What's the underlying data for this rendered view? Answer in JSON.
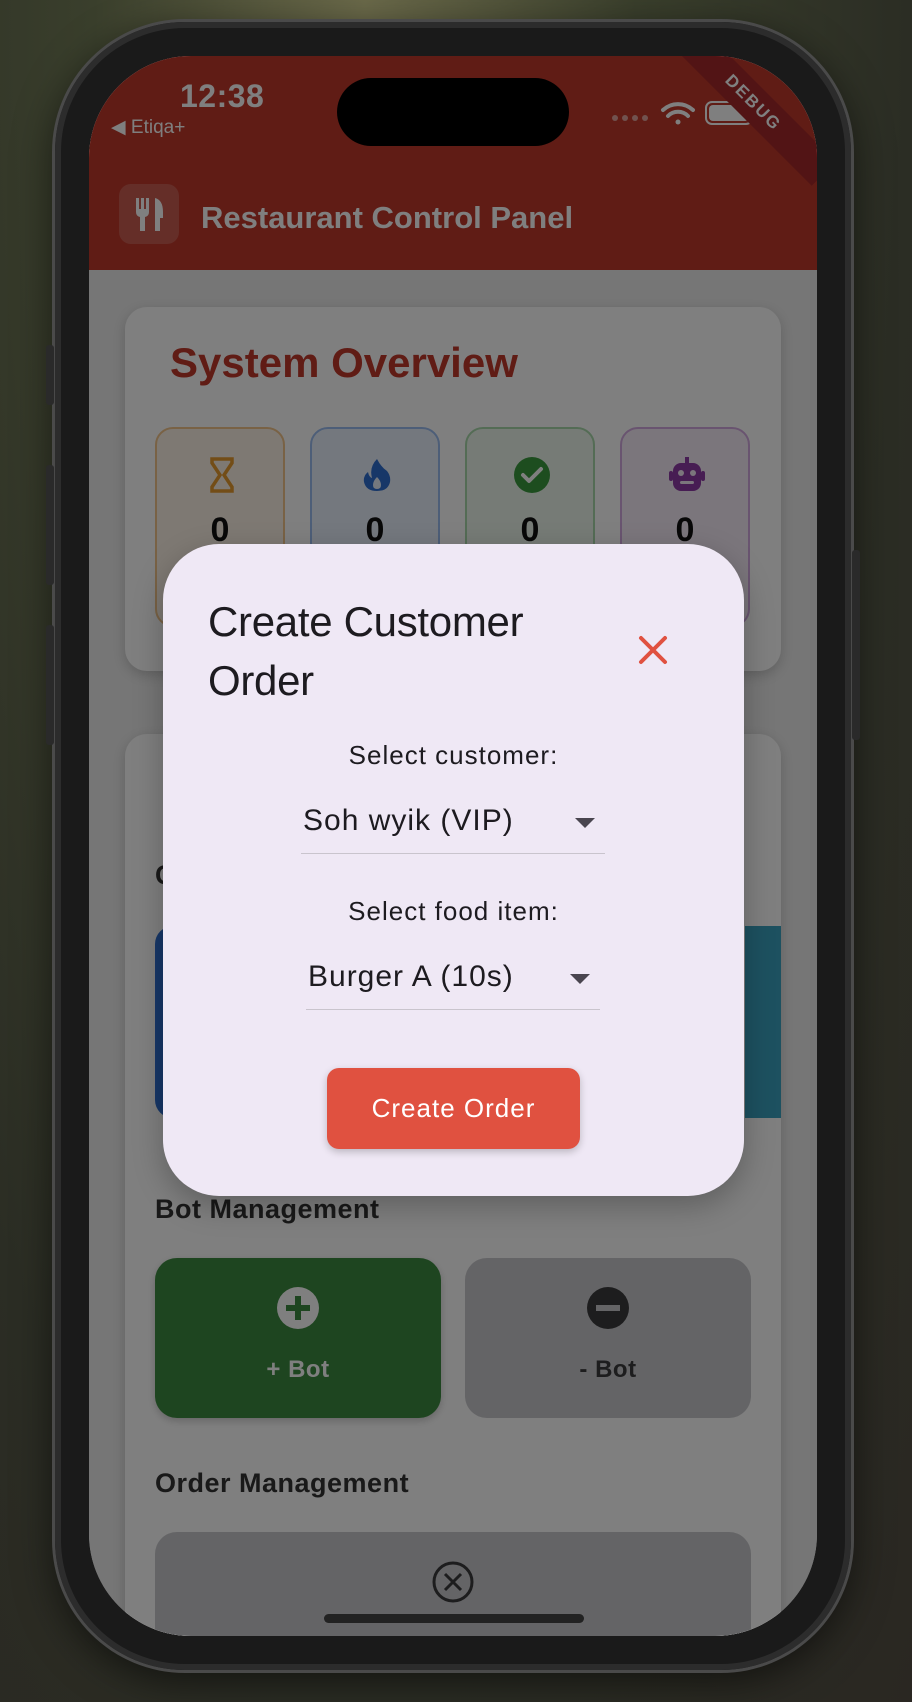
{
  "status_bar": {
    "time": "12:38",
    "back_app": "◀ Etiqa+",
    "debug_label": "DEBUG"
  },
  "app_bar": {
    "title": "Restaurant Control Panel",
    "icon": "fork-knife-icon"
  },
  "overview": {
    "title": "System Overview",
    "stats": [
      {
        "icon": "hourglass-icon",
        "value": "0",
        "color": "#e69a2e"
      },
      {
        "icon": "fire-icon",
        "value": "0",
        "color": "#2f6fd0"
      },
      {
        "icon": "check-circle-icon",
        "value": "0",
        "color": "#3a9a3e"
      },
      {
        "icon": "robot-icon",
        "value": "0",
        "color": "#8e3aa6"
      }
    ]
  },
  "partial_letter": "C",
  "bot_management": {
    "title": "Bot Management",
    "add_label": "+ Bot",
    "remove_label": "- Bot"
  },
  "order_management": {
    "title": "Order Management"
  },
  "dialog": {
    "title": "Create Customer Order",
    "customer_label": "Select customer:",
    "customer_value": "Soh wyik (VIP)",
    "food_label": "Select food item:",
    "food_value": "Burger A (10s)",
    "submit_label": "Create Order"
  },
  "colors": {
    "primary": "#c0392b",
    "accent_button": "#e05140",
    "dialog_bg": "#efe8f5",
    "add_bot": "#3d8b40",
    "remove_bot": "#c9c9cc"
  }
}
